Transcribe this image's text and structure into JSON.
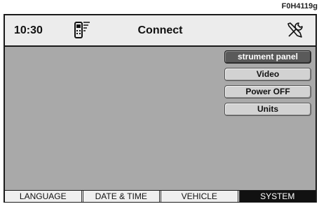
{
  "figure_code": "F0H4119g",
  "header": {
    "time": "10:30",
    "title": "Connect",
    "phone_icon": "phone-signal-icon",
    "tools_icon": "wrench-screwdriver-icon"
  },
  "menu": {
    "items": [
      {
        "label": "strument panel",
        "active": true
      },
      {
        "label": "Video",
        "active": false
      },
      {
        "label": "Power OFF",
        "active": false
      },
      {
        "label": "Units",
        "active": false
      }
    ]
  },
  "tabs": [
    {
      "label": "LANGUAGE",
      "active": false
    },
    {
      "label": "DATE & TIME",
      "active": false
    },
    {
      "label": "VEHICLE",
      "active": false
    },
    {
      "label": "SYSTEM",
      "active": true
    }
  ],
  "colors": {
    "content_bg": "#a9a9a9",
    "header_bg": "#ececec",
    "active_button": "#5a5a5a",
    "active_tab": "#111111"
  }
}
